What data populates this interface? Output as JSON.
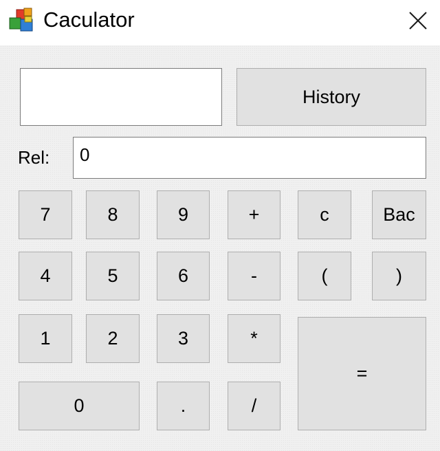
{
  "window": {
    "title": "Caculator",
    "icon": "blocks-app-icon",
    "close_icon": "close-icon"
  },
  "history_button": "History",
  "result_label": "Rel:",
  "input_value": "0",
  "buttons": {
    "seven": "7",
    "eight": "8",
    "nine": "9",
    "plus": "+",
    "clear": "c",
    "back": "Bac",
    "four": "4",
    "five": "5",
    "six": "6",
    "minus": "-",
    "open_paren": "(",
    "close_paren": ")",
    "one": "1",
    "two": "2",
    "three": "3",
    "multiply": "*",
    "equals": "=",
    "zero": "0",
    "dot": ".",
    "divide": "/"
  },
  "colors": {
    "button_face": "#e1e1e1",
    "button_border": "#adadad",
    "client_background": "#f0f0f0"
  }
}
